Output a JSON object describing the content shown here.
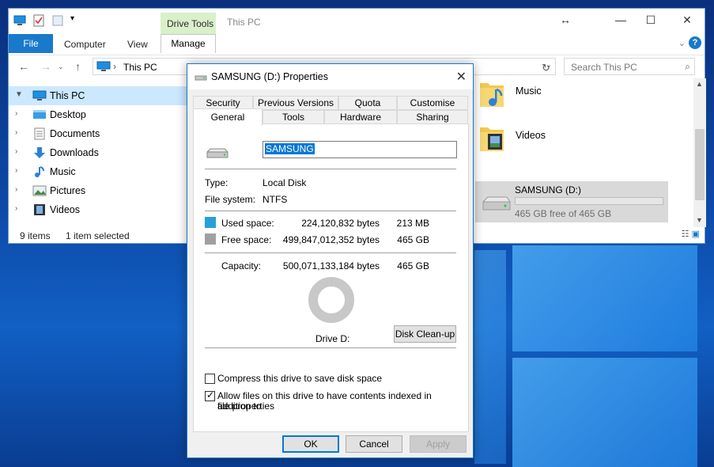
{
  "explorer": {
    "title": "This PC",
    "context_tab_group": "Drive Tools",
    "ribbon_tabs": [
      "File",
      "Computer",
      "View",
      "Manage"
    ],
    "address": "This PC",
    "search_placeholder": "Search This PC",
    "nav_items": [
      {
        "label": "This PC",
        "icon": "pc-icon",
        "selected": true
      },
      {
        "label": "Desktop",
        "icon": "desktop-folder-icon"
      },
      {
        "label": "Documents",
        "icon": "documents-folder-icon"
      },
      {
        "label": "Downloads",
        "icon": "downloads-folder-icon"
      },
      {
        "label": "Music",
        "icon": "music-folder-icon"
      },
      {
        "label": "Pictures",
        "icon": "pictures-folder-icon"
      },
      {
        "label": "Videos",
        "icon": "videos-folder-icon"
      }
    ],
    "content_items": [
      {
        "label": "Music",
        "icon": "music-folder-icon"
      },
      {
        "label": "Videos",
        "icon": "videos-folder-icon"
      }
    ],
    "drive_tile": {
      "name": "SAMSUNG (D:)",
      "free_text": "465 GB free of 465 GB",
      "used_fraction": 0.0004
    },
    "status": {
      "items": "9 items",
      "selected": "1 item selected"
    }
  },
  "dialog": {
    "title": "SAMSUNG (D:) Properties",
    "tabs_row1": [
      "Security",
      "Previous Versions",
      "Quota",
      "Customise"
    ],
    "tabs_row2": [
      "General",
      "Tools",
      "Hardware",
      "Sharing"
    ],
    "active_tab": "General",
    "drive_label_value": "SAMSUNG",
    "type_label": "Type:",
    "type_value": "Local Disk",
    "fs_label": "File system:",
    "fs_value": "NTFS",
    "used_label": "Used space:",
    "used_bytes": "224,120,832 bytes",
    "used_size": "213 MB",
    "free_label": "Free space:",
    "free_bytes": "499,847,012,352 bytes",
    "free_size": "465 GB",
    "capacity_label": "Capacity:",
    "capacity_bytes": "500,071,133,184 bytes",
    "capacity_size": "465 GB",
    "drive_caption": "Drive D:",
    "cleanup_button": "Disk Clean-up",
    "compress_label": "Compress this drive to save disk space",
    "compress_checked": false,
    "index_label_line1": "Allow files on this drive to have contents indexed in addition to",
    "index_label_line2": "file properties",
    "index_checked": true,
    "ok_button": "OK",
    "cancel_button": "Cancel",
    "apply_button": "Apply",
    "colors": {
      "used": "#26a0da",
      "free": "#a0a0a0",
      "accent": "#0078d7"
    }
  }
}
